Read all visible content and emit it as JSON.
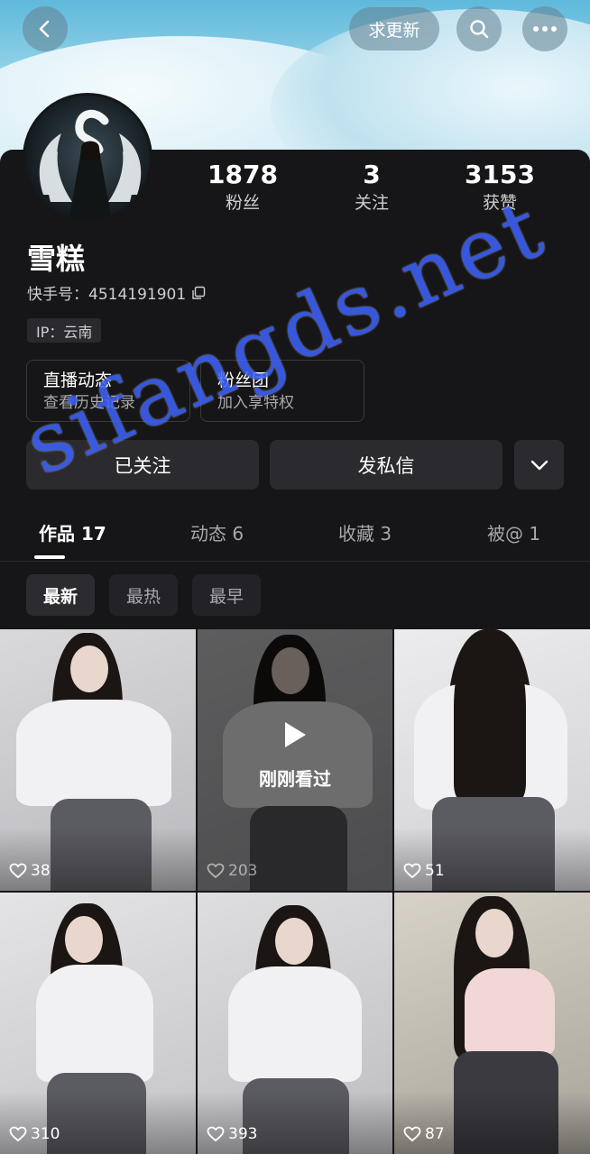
{
  "header": {
    "refresh_label": "求更新",
    "icons": [
      "back-icon",
      "search-icon",
      "more-icon"
    ]
  },
  "profile": {
    "stats": [
      {
        "value": "1878",
        "label": "粉丝"
      },
      {
        "value": "3",
        "label": "关注"
      },
      {
        "value": "3153",
        "label": "获赞"
      }
    ],
    "nickname": "雪糕",
    "kuaishou_id_label": "快手号：4514191901",
    "ip_label": "IP：云南",
    "cards": [
      {
        "title": "直播动态",
        "subtitle": "查看历史记录"
      },
      {
        "title": "粉丝团",
        "subtitle": "加入享特权"
      }
    ],
    "follow_label": "已关注",
    "message_label": "发私信"
  },
  "tabs": [
    {
      "label": "作品 17",
      "active": true
    },
    {
      "label": "动态 6",
      "active": false
    },
    {
      "label": "收藏 3",
      "active": false
    },
    {
      "label": "被@ 1",
      "active": false
    }
  ],
  "sort_chips": [
    {
      "label": "最新",
      "active": true
    },
    {
      "label": "最热",
      "active": false
    },
    {
      "label": "最早",
      "active": false
    }
  ],
  "videos": [
    {
      "likes": "38",
      "recent": false
    },
    {
      "likes": "203",
      "recent": true,
      "recent_label": "刚刚看过"
    },
    {
      "likes": "51",
      "recent": false
    },
    {
      "likes": "310",
      "recent": false
    },
    {
      "likes": "393",
      "recent": false
    },
    {
      "likes": "87",
      "recent": false
    }
  ],
  "watermark": "sifangds.net"
}
